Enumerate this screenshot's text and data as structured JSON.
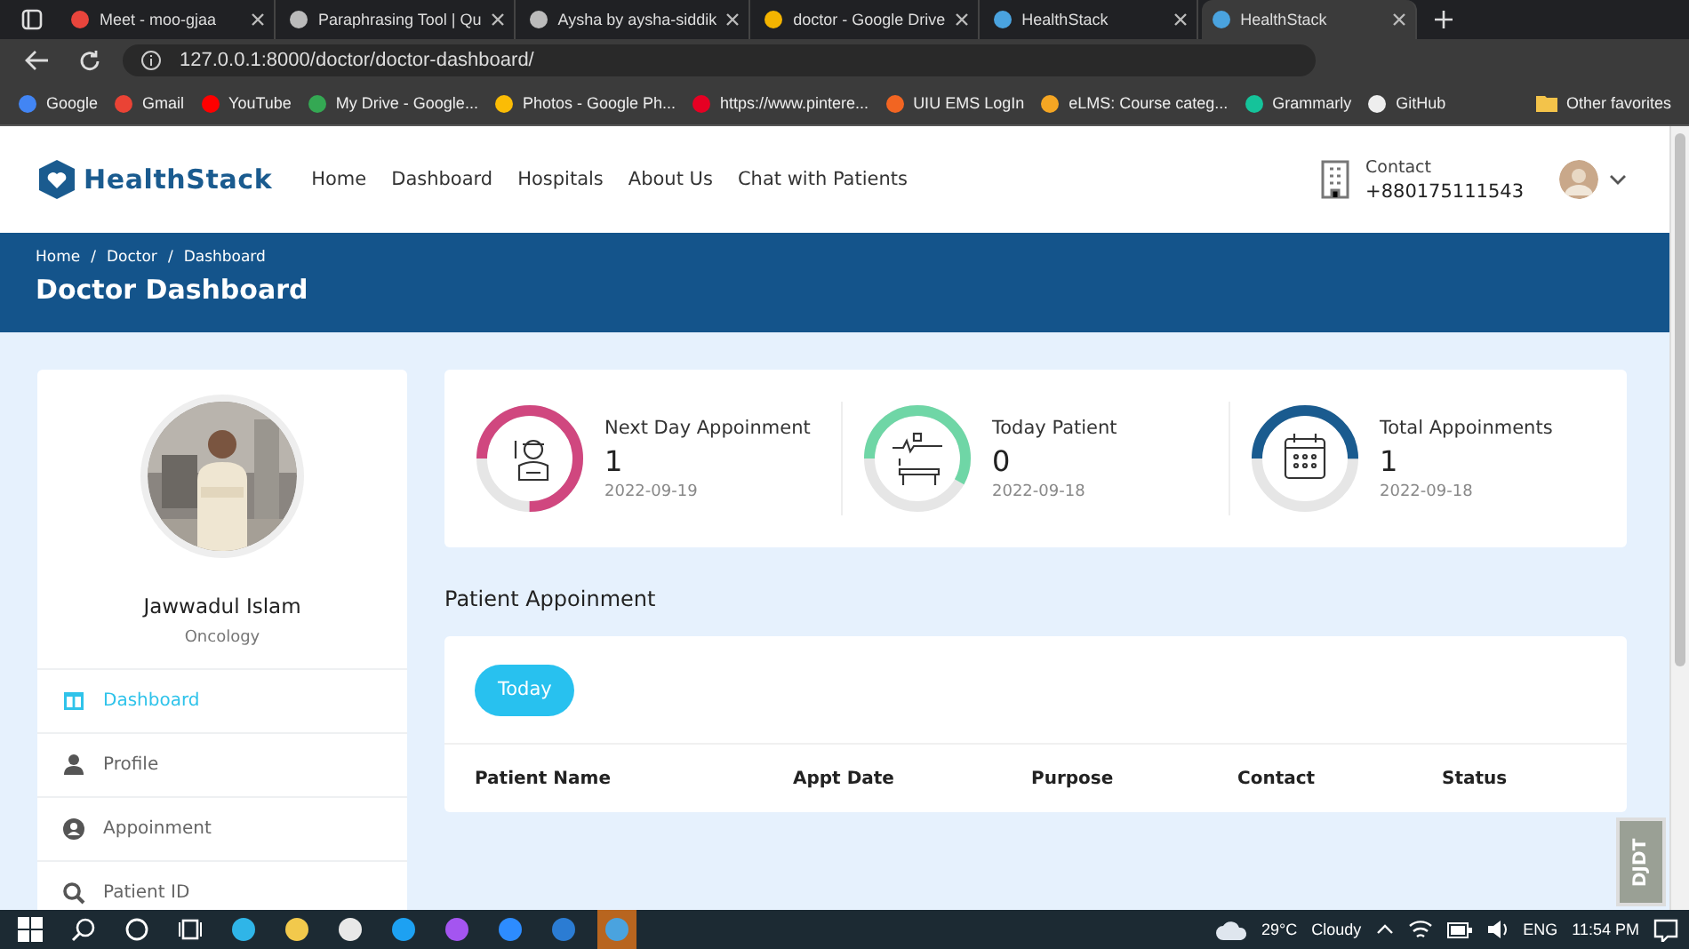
{
  "browser": {
    "tabs": [
      {
        "title": "Meet - moo-gjaa",
        "selected": false
      },
      {
        "title": "Paraphrasing Tool | Qu",
        "selected": false
      },
      {
        "title": "Aysha by aysha-siddik",
        "selected": false
      },
      {
        "title": "doctor - Google Drive",
        "selected": false
      },
      {
        "title": "HealthStack",
        "selected": false
      },
      {
        "title": "HealthStack",
        "selected": true
      }
    ],
    "address": "127.0.0.1:8000/doctor/doctor-dashboard/",
    "bookmarks": [
      "Google",
      "Gmail",
      "YouTube",
      "My Drive - Google...",
      "Photos - Google Ph...",
      "https://www.pintere...",
      "UIU EMS LogIn",
      "eLMS: Course categ...",
      "Grammarly",
      "GitHub"
    ],
    "other_favorites": "Other favorites"
  },
  "header": {
    "logo": "HealthStack",
    "nav": [
      "Home",
      "Dashboard",
      "Hospitals",
      "About Us",
      "Chat with Patients"
    ],
    "contact_label": "Contact",
    "contact_phone": "+880175111543"
  },
  "banner": {
    "breadcrumb": [
      "Home",
      "Doctor",
      "Dashboard"
    ],
    "separators": [
      "/",
      "/"
    ],
    "title": "Doctor Dashboard"
  },
  "profile": {
    "name": "Jawwadul Islam",
    "department": "Oncology",
    "menu": [
      {
        "label": "Dashboard",
        "selected": true
      },
      {
        "label": "Profile",
        "selected": false
      },
      {
        "label": "Appoinment",
        "selected": false
      },
      {
        "label": "Patient ID",
        "selected": false
      }
    ]
  },
  "stats": [
    {
      "label": "Next Day Appoinment",
      "value": "1",
      "date": "2022-09-19",
      "level": 0.75,
      "color": "#d0477f"
    },
    {
      "label": "Today Patient",
      "value": "0",
      "date": "2022-09-18",
      "level": 0.58,
      "color": "#6fd6a6"
    },
    {
      "label": "Total Appoinments",
      "value": "1",
      "date": "2022-09-18",
      "level": 0.5,
      "color": "#1a5b8f"
    }
  ],
  "appointments": {
    "title": "Patient Appoinment",
    "filter_button": "Today",
    "columns": [
      "Patient Name",
      "Appt Date",
      "Purpose",
      "Contact",
      "Status"
    ]
  },
  "debug_toolbar": "DJDT",
  "taskbar": {
    "temperature": "29°C",
    "weather": "Cloudy",
    "language": "ENG",
    "time": "11:54 PM"
  }
}
